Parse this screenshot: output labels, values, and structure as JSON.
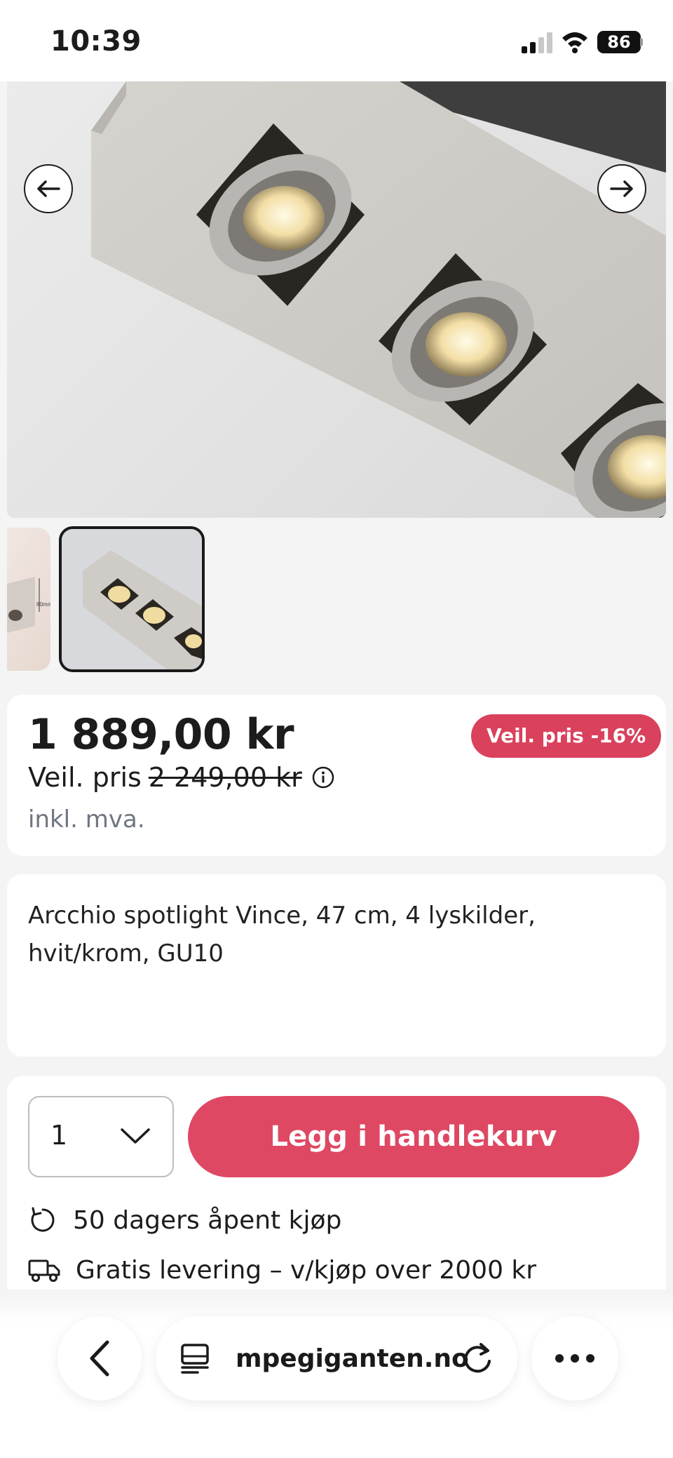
{
  "status_bar": {
    "time": "10:39",
    "battery": "86"
  },
  "gallery": {
    "prev_icon": "arrow-left-icon",
    "next_icon": "arrow-right-icon",
    "thumb_dimension_label": "80mm"
  },
  "product": {
    "price": "1 889,00 kr",
    "discount_badge": "Veil. pris -16%",
    "rrp_label": "Veil. pris",
    "rrp_value": "2 249,00 kr",
    "vat_note": "inkl. mva.",
    "title": "Arcchio spotlight Vince, 47 cm, 4 lyskilder, hvit/krom, GU10"
  },
  "purchase": {
    "quantity": "1",
    "add_to_cart_label": "Legg i handlekurv",
    "perks": [
      {
        "icon": "return-icon",
        "text": "50 dagers åpent kjøp"
      },
      {
        "icon": "truck-icon",
        "text": "Gratis levering – v/kjøp over 2000 kr"
      }
    ]
  },
  "browser": {
    "url_display": "mpegiganten.no"
  },
  "colors": {
    "accent": "#de4863",
    "badge": "#d9415d",
    "muted_text": "#6f7680"
  }
}
